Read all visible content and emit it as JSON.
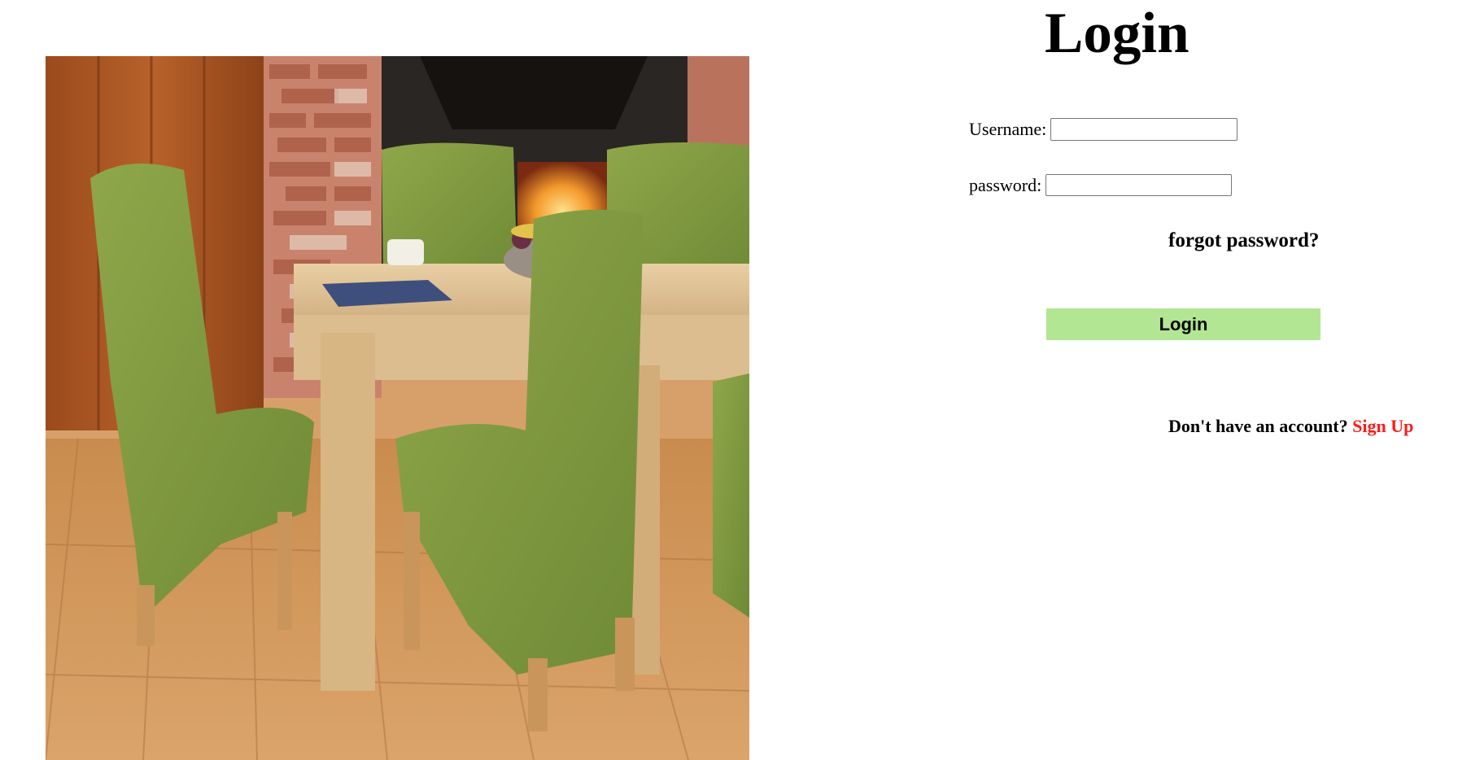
{
  "login": {
    "title": "Login",
    "username_label": "Username:",
    "username_value": "",
    "password_label": "password:",
    "password_value": "",
    "forgot_password": "forgot password?",
    "login_button": "Login",
    "no_account_text": "Don't have an account?",
    "signup_link": "Sign Up"
  },
  "colors": {
    "button_background": "#b2e693",
    "signup_link": "#ff1a1a"
  }
}
